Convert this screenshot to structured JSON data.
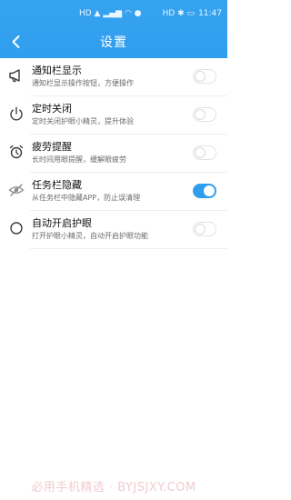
{
  "status_bar": {
    "left_indicators": "HD ▲ ▂▄▆ ◠ ●",
    "right_indicators": "HD ✱ ▭",
    "time": "11:47"
  },
  "header": {
    "title": "设置",
    "back_icon": "chevron-left-icon"
  },
  "settings": [
    {
      "title": "通知栏显示",
      "subtitle": "通知栏显示操作按钮，方便操作",
      "icon": "megaphone-icon",
      "enabled": false
    },
    {
      "title": "定时关闭",
      "subtitle": "定时关闭护眼小精灵，提升体验",
      "icon": "power-icon",
      "enabled": false
    },
    {
      "title": "疲劳提醒",
      "subtitle": "长时间用眼提醒，缓解眼疲劳",
      "icon": "alarm-clock-icon",
      "enabled": false
    },
    {
      "title": "任务栏隐藏",
      "subtitle": "从任务栏中隐藏APP，防止误清理",
      "icon": "eye-hidden-icon",
      "enabled": true
    },
    {
      "title": "自动开启护眼",
      "subtitle": "打开护眼小精灵，自动开启护眼功能",
      "icon": "radio-icon",
      "enabled": false
    }
  ],
  "colors": {
    "accent": "#2f9eee",
    "header": "#36a3ef"
  },
  "watermark": "必用手机精选 · BYJSJXY.COM"
}
